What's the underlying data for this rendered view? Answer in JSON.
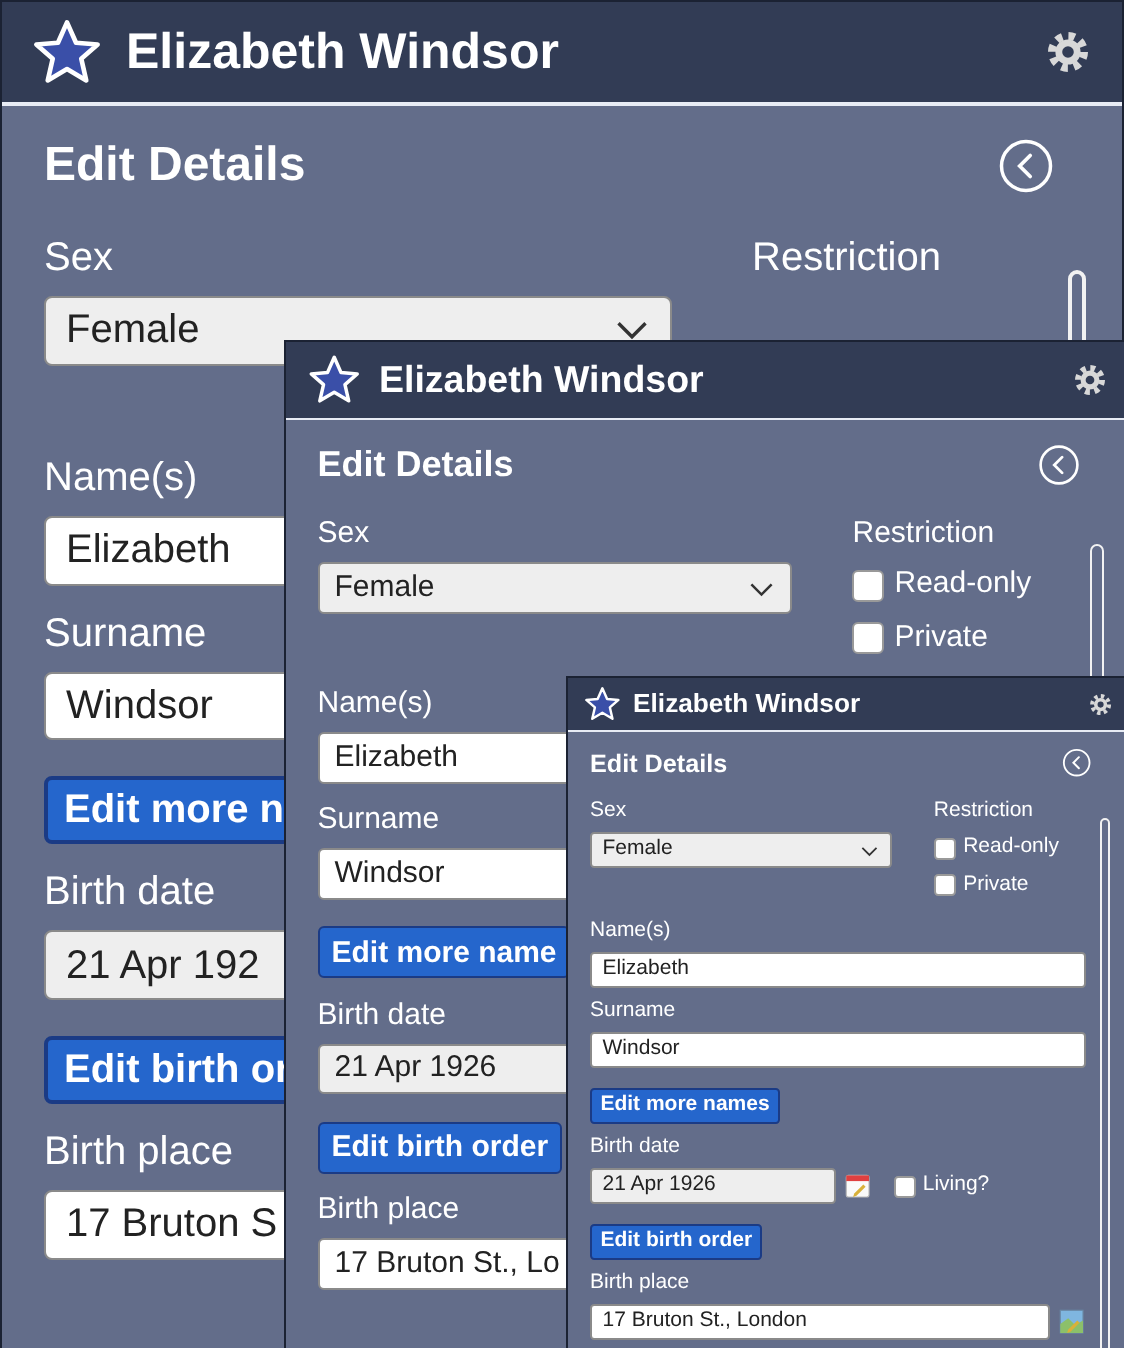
{
  "windows": [
    {
      "title": "Elizabeth Windsor",
      "heading": "Edit Details",
      "sex": {
        "label": "Sex",
        "value": "Female"
      },
      "restriction": {
        "label": "Restriction"
      },
      "rows": [
        {
          "kind": "field",
          "label": "Name(s)",
          "value": "Elizabeth"
        },
        {
          "kind": "field",
          "label": "Surname",
          "value": "Windsor"
        },
        {
          "kind": "button",
          "label": "Edit more n"
        },
        {
          "kind": "date",
          "label": "Birth date",
          "value": "21 Apr 192"
        },
        {
          "kind": "button",
          "label": "Edit birth or"
        },
        {
          "kind": "place",
          "label": "Birth place",
          "value": "17 Bruton S"
        }
      ]
    },
    {
      "title": "Elizabeth Windsor",
      "heading": "Edit Details",
      "sex": {
        "label": "Sex",
        "value": "Female"
      },
      "restriction": {
        "label": "Restriction",
        "options": [
          {
            "label": "Read-only",
            "checked": false
          },
          {
            "label": "Private",
            "checked": false
          }
        ]
      },
      "rows": [
        {
          "kind": "field",
          "label": "Name(s)",
          "value": "Elizabeth"
        },
        {
          "kind": "field",
          "label": "Surname",
          "value": "Windsor"
        },
        {
          "kind": "button",
          "label": "Edit more name"
        },
        {
          "kind": "date",
          "label": "Birth date",
          "value": "21 Apr 1926"
        },
        {
          "kind": "button",
          "label": "Edit birth order"
        },
        {
          "kind": "place",
          "label": "Birth place",
          "value": "17 Bruton St., Lo"
        }
      ]
    },
    {
      "title": "Elizabeth Windsor",
      "heading": "Edit Details",
      "sex": {
        "label": "Sex",
        "value": "Female"
      },
      "restriction": {
        "label": "Restriction",
        "options": [
          {
            "label": "Read-only",
            "checked": false
          },
          {
            "label": "Private",
            "checked": false
          }
        ]
      },
      "rows": [
        {
          "kind": "field",
          "label": "Name(s)",
          "value": "Elizabeth"
        },
        {
          "kind": "field",
          "label": "Surname",
          "value": "Windsor"
        },
        {
          "kind": "button",
          "label": "Edit more names"
        },
        {
          "kind": "date",
          "label": "Birth date",
          "value": "21 Apr 1926",
          "picker": true,
          "living": {
            "label": "Living?",
            "checked": false
          }
        },
        {
          "kind": "button",
          "label": "Edit birth order"
        },
        {
          "kind": "place",
          "label": "Birth place",
          "value": "17 Bruton St., London",
          "picker": true
        }
      ]
    }
  ]
}
